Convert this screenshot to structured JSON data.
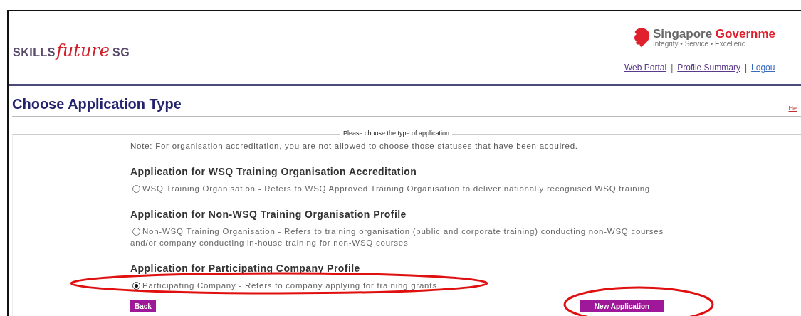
{
  "header": {
    "logo": {
      "prefix": "SKILLS",
      "script": "future",
      "suffix": "SG"
    },
    "gov": {
      "name_1": "Singapore",
      "name_2": "Governme",
      "motto": "Integrity • Service • Excellenc"
    },
    "links": [
      {
        "label": "Web Portal"
      },
      {
        "label": "Profile Summary"
      },
      {
        "label": "Logou"
      }
    ],
    "separator": "|"
  },
  "page_title": "Choose Application Type",
  "help_link": "He",
  "form": {
    "legend": "Please choose the type of application",
    "note": "Note: For organisation accreditation, you are not allowed to choose those statuses that have been acquired.",
    "sections": [
      {
        "heading": "Application for WSQ Training Organisation Accreditation",
        "option": "WSQ Training Organisation - Refers to WSQ Approved Training Organisation to deliver nationally recognised WSQ training",
        "selected": false
      },
      {
        "heading": "Application for Non-WSQ Training Organisation Profile",
        "option": "Non-WSQ Training Organisation - Refers to training organisation (public and corporate training) conducting non-WSQ courses and/or company conducting in-house training for non-WSQ courses",
        "selected": false
      },
      {
        "heading": "Application for Participating Company Profile",
        "option": "Participating Company - Refers to company applying for training grants",
        "selected": true
      }
    ],
    "buttons": [
      {
        "label": "Back",
        "kind": "back"
      },
      {
        "label": "New Application",
        "kind": "new"
      }
    ]
  }
}
